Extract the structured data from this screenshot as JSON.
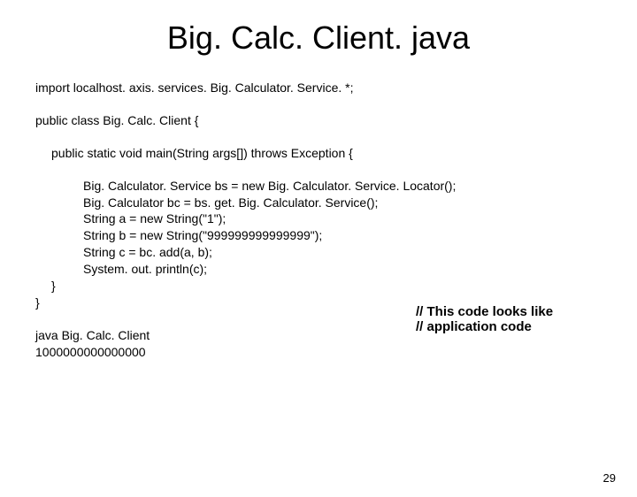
{
  "title": "Big. Calc. Client. java",
  "lines": {
    "import": "import localhost. axis. services. Big. Calculator. Service. *;",
    "classDecl": "public class Big. Calc. Client {",
    "mainDecl": "public static void main(String args[]) throws Exception {",
    "l1": "Big. Calculator. Service bs = new Big. Calculator. Service. Locator();",
    "l2": "Big. Calculator bc = bs. get. Big. Calculator. Service();",
    "l3": "String a = new String(\"1\");",
    "l4": "String b = new String(\"999999999999999\");",
    "l5": "String c = bc. add(a, b);",
    "l6": "System. out. println(c);",
    "close1": "}",
    "close2": "}",
    "run1": "java Big. Calc. Client",
    "run2": "1000000000000000"
  },
  "annotation": {
    "a1": "// This code looks like",
    "a2": "// application code"
  },
  "pageNumber": "29"
}
